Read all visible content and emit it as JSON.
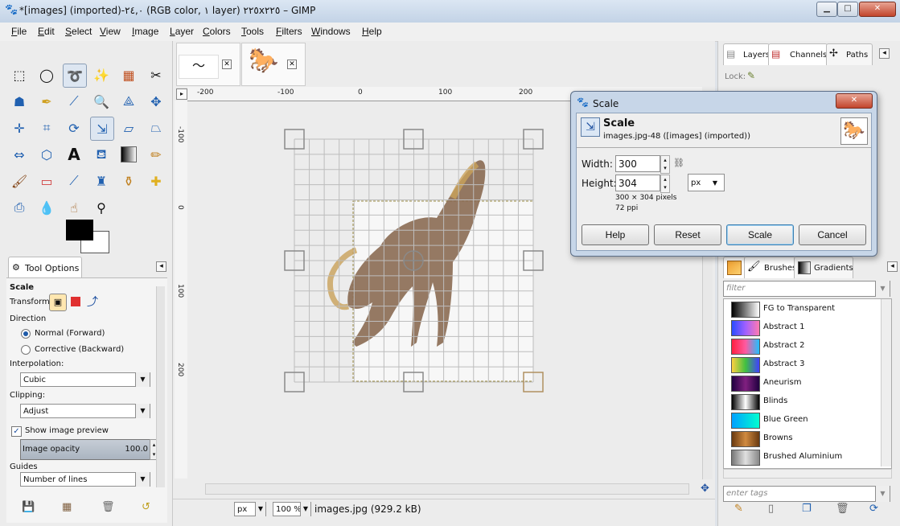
{
  "window": {
    "title": "*[images] (imported)-٢٤,٠ (RGB color, ١ layer) ٢٢٥x٢٢٥ – GIMP",
    "minimize": "▁",
    "maximize": "□",
    "close": "✕"
  },
  "menu": [
    "File",
    "Edit",
    "Select",
    "View",
    "Image",
    "Layer",
    "Colors",
    "Tools",
    "Filters",
    "Windows",
    "Help"
  ],
  "tool_options": {
    "tab_label": "Tool Options",
    "tool_name": "Scale",
    "transform_label": "Transform:",
    "direction_label": "Direction",
    "direction_normal": "Normal (Forward)",
    "direction_corrective": "Corrective (Backward)",
    "interpolation_label": "Interpolation:",
    "interpolation_value": "Cubic",
    "clipping_label": "Clipping:",
    "clipping_value": "Adjust",
    "show_preview_label": "Show image preview",
    "show_preview_checked": true,
    "opacity_label": "Image opacity",
    "opacity_value": "100.0",
    "guides_label": "Guides",
    "guides_value": "Number of lines"
  },
  "rulers": {
    "h": [
      "-200",
      "-100",
      "0",
      "100",
      "200"
    ],
    "v": [
      "-100",
      "0",
      "100",
      "200"
    ]
  },
  "status": {
    "unit": "px",
    "zoom": "100 %",
    "info": "images.jpg (929.2 kB)"
  },
  "dock": {
    "tabs": [
      "Layers",
      "Channels",
      "Paths"
    ],
    "lock_label": "Lock:",
    "brush_tabs": [
      "Brushes",
      "Gradients"
    ],
    "filter_placeholder": "filter",
    "tags_placeholder": "enter tags",
    "gradients": [
      {
        "name": "FG to Transparent",
        "colors": [
          "#000000",
          "#ffffff"
        ]
      },
      {
        "name": "Abstract 1",
        "colors": [
          "#2b4cff",
          "#a060ff",
          "#ff7ab0"
        ]
      },
      {
        "name": "Abstract 2",
        "colors": [
          "#ff2040",
          "#ff5aa0",
          "#20c0ff"
        ]
      },
      {
        "name": "Abstract 3",
        "colors": [
          "#ffd040",
          "#40c040",
          "#4040ff"
        ]
      },
      {
        "name": "Aneurism",
        "colors": [
          "#200040",
          "#802080",
          "#200040"
        ]
      },
      {
        "name": "Blinds",
        "colors": [
          "#000000",
          "#ffffff",
          "#000000"
        ]
      },
      {
        "name": "Blue Green",
        "colors": [
          "#00a0ff",
          "#00ffd0"
        ]
      },
      {
        "name": "Browns",
        "colors": [
          "#6a3a10",
          "#d08a40",
          "#6a3a10"
        ]
      },
      {
        "name": "Brushed Aluminium",
        "colors": [
          "#777777",
          "#e0e0e0",
          "#888888"
        ]
      }
    ]
  },
  "scale_dialog": {
    "window_title": "Scale",
    "heading": "Scale",
    "subtitle": "images.jpg-48 ([images] (imported))",
    "width_label": "Width:",
    "width_value": "300",
    "height_label": "Height:",
    "height_value": "304",
    "size_info": "300 × 304 pixels",
    "ppi_info": "72 ppi",
    "unit": "px",
    "buttons": [
      "Help",
      "Reset",
      "Scale",
      "Cancel"
    ]
  }
}
